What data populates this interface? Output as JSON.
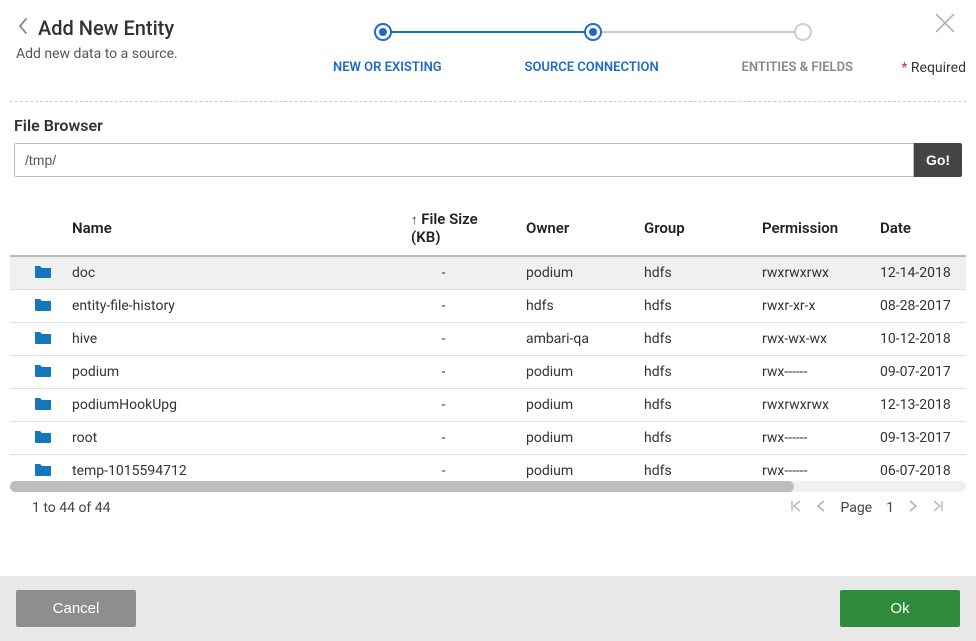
{
  "header": {
    "title": "Add New Entity",
    "subtitle": "Add new data to a source.",
    "required_label": "Required"
  },
  "stepper": {
    "steps": [
      {
        "label": "NEW OR EXISTING",
        "state": "done"
      },
      {
        "label": "SOURCE CONNECTION",
        "state": "active"
      },
      {
        "label": "ENTITIES & FIELDS",
        "state": "idle"
      }
    ]
  },
  "browser": {
    "section_title": "File Browser",
    "path": "/tmp/",
    "go_label": "Go!",
    "columns": {
      "name": "Name",
      "size": "File Size (KB)",
      "owner": "Owner",
      "group": "Group",
      "permission": "Permission",
      "date": "Date",
      "sort_indicator": "↑"
    },
    "rows": [
      {
        "name": "doc",
        "size": "-",
        "owner": "podium",
        "group": "hdfs",
        "permission": "rwxrwxrwx",
        "date": "12-14-2018",
        "selected": true
      },
      {
        "name": "entity-file-history",
        "size": "-",
        "owner": "hdfs",
        "group": "hdfs",
        "permission": "rwxr-xr-x",
        "date": "08-28-2017",
        "selected": false
      },
      {
        "name": "hive",
        "size": "-",
        "owner": "ambari-qa",
        "group": "hdfs",
        "permission": "rwx-wx-wx",
        "date": "10-12-2018",
        "selected": false
      },
      {
        "name": "podium",
        "size": "-",
        "owner": "podium",
        "group": "hdfs",
        "permission": "rwx------",
        "date": "09-07-2017",
        "selected": false
      },
      {
        "name": "podiumHookUpg",
        "size": "-",
        "owner": "podium",
        "group": "hdfs",
        "permission": "rwxrwxrwx",
        "date": "12-13-2018",
        "selected": false
      },
      {
        "name": "root",
        "size": "-",
        "owner": "podium",
        "group": "hdfs",
        "permission": "rwx------",
        "date": "09-13-2017",
        "selected": false
      },
      {
        "name": "temp-1015594712",
        "size": "-",
        "owner": "podium",
        "group": "hdfs",
        "permission": "rwx------",
        "date": "06-07-2018",
        "selected": false
      }
    ],
    "pager": {
      "summary": "1 to 44 of 44",
      "page_label": "Page",
      "page_num": "1"
    }
  },
  "footer": {
    "cancel": "Cancel",
    "ok": "Ok"
  }
}
